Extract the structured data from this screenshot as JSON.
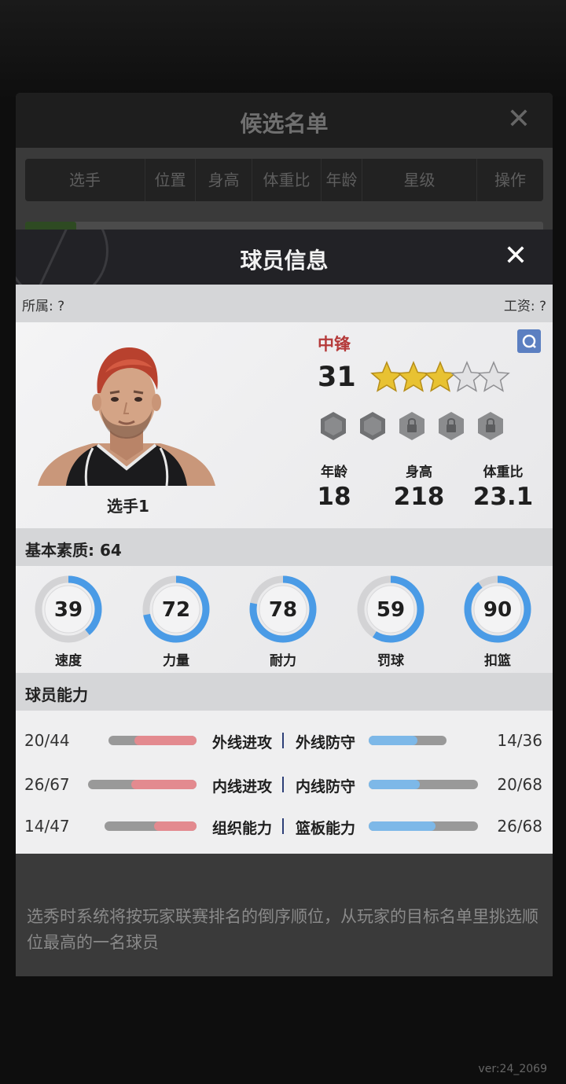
{
  "candidate_list": {
    "title": "候选名单",
    "columns": [
      "选手",
      "位置",
      "身高",
      "体重比",
      "年龄",
      "星级",
      "操作"
    ],
    "note": "选秀时系统将按玩家联赛排名的倒序顺位，从玩家的目标名单里挑选顺位最高的一名球员"
  },
  "player_info": {
    "title": "球员信息",
    "team_label": "所属: ?",
    "salary_label": "工资: ?",
    "name": "选手1",
    "position": "中锋",
    "overall": "31",
    "stars_filled": 3,
    "stars_total": 5,
    "stats": [
      {
        "label": "年龄",
        "value": "18"
      },
      {
        "label": "身高",
        "value": "218"
      },
      {
        "label": "体重比",
        "value": "23.1"
      }
    ],
    "basic_quality_label": "基本素质: 64",
    "gauges": [
      {
        "label": "速度",
        "value": 39
      },
      {
        "label": "力量",
        "value": 72
      },
      {
        "label": "耐力",
        "value": 78
      },
      {
        "label": "罚球",
        "value": 59
      },
      {
        "label": "扣篮",
        "value": 90
      }
    ],
    "abilities_label": "球员能力",
    "abilities": [
      {
        "left_name": "外线进攻",
        "left_value": "20/44",
        "left_cur": 20,
        "left_max": 44,
        "right_name": "外线防守",
        "right_value": "14/36",
        "right_cur": 14,
        "right_max": 36
      },
      {
        "left_name": "内线进攻",
        "left_value": "26/67",
        "left_cur": 26,
        "left_max": 67,
        "right_name": "内线防守",
        "right_value": "20/68",
        "right_cur": 20,
        "right_max": 68
      },
      {
        "left_name": "组织能力",
        "left_value": "14/47",
        "left_cur": 14,
        "left_max": 47,
        "right_name": "篮板能力",
        "right_value": "26/68",
        "right_cur": 26,
        "right_max": 68
      }
    ]
  },
  "version": "ver:24_2069",
  "colors": {
    "gauge_blue": "#4a9be6",
    "bar_red": "#e38a8f",
    "bar_blue": "#7db8e8",
    "position_red": "#b53a3a",
    "star_gold": "#e8c232"
  },
  "icons": {
    "close": "close-icon",
    "search": "search-icon",
    "star": "star-icon",
    "badge_locked": "lock-badge-icon",
    "badge_empty": "empty-badge-icon"
  }
}
